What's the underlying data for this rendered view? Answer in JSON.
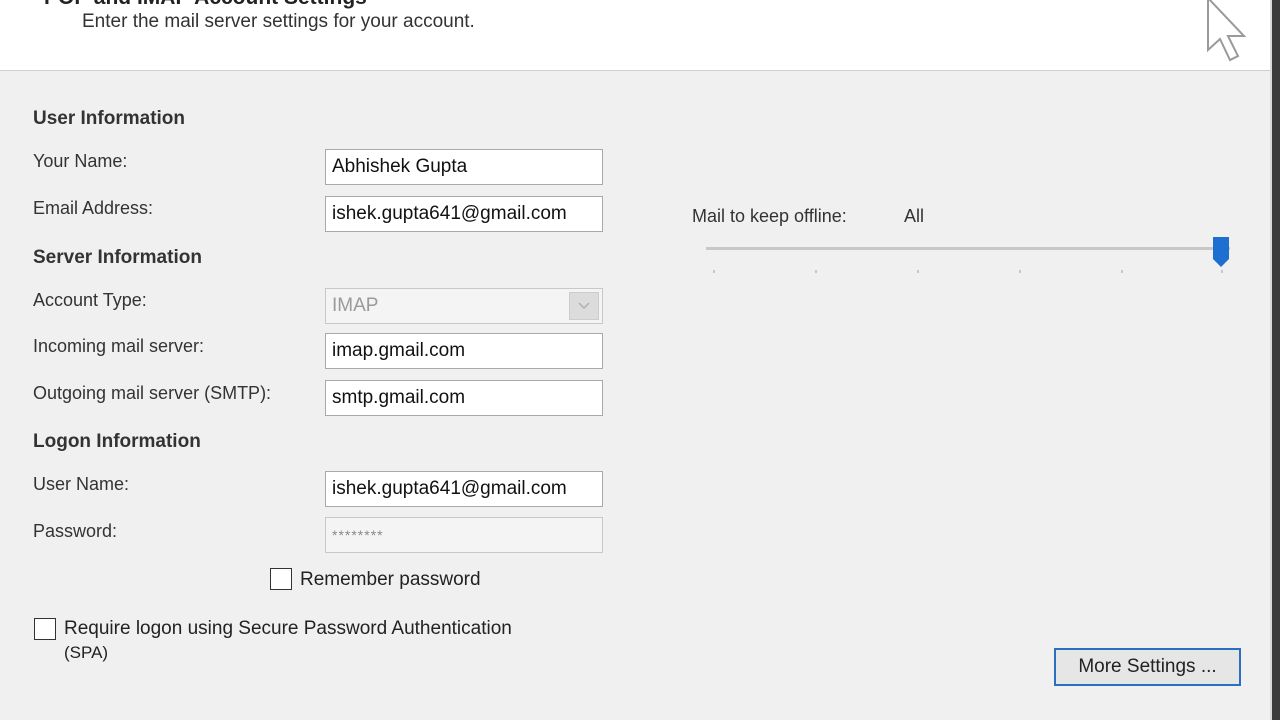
{
  "header": {
    "title": "POP and IMAP Account Settings",
    "subtitle": "Enter the mail server settings for your account."
  },
  "user_info": {
    "heading": "User Information",
    "name_label": "Your Name:",
    "name_value": "Abhishek Gupta",
    "email_label": "Email Address:",
    "email_value": "ishek.gupta641@gmail.com"
  },
  "server_info": {
    "heading": "Server Information",
    "account_type_label": "Account Type:",
    "account_type_value": "IMAP",
    "incoming_label": "Incoming mail server:",
    "incoming_value": "imap.gmail.com",
    "outgoing_label": "Outgoing mail server (SMTP):",
    "outgoing_value": "smtp.gmail.com"
  },
  "logon_info": {
    "heading": "Logon Information",
    "username_label": "User Name:",
    "username_value": "ishek.gupta641@gmail.com",
    "password_label": "Password:",
    "password_value": "********",
    "remember_label": "Remember password",
    "remember_checked": false,
    "spa_label_line1": "Require logon using Secure Password Authentication",
    "spa_label_line2": "(SPA)",
    "spa_checked": false
  },
  "offline": {
    "label": "Mail to keep offline:",
    "value": "All",
    "slider_level": 1.0
  },
  "buttons": {
    "more_settings": "More Settings ..."
  },
  "colors": {
    "accent": "#2a6fc0",
    "slider_thumb": "#1e6fd0"
  }
}
